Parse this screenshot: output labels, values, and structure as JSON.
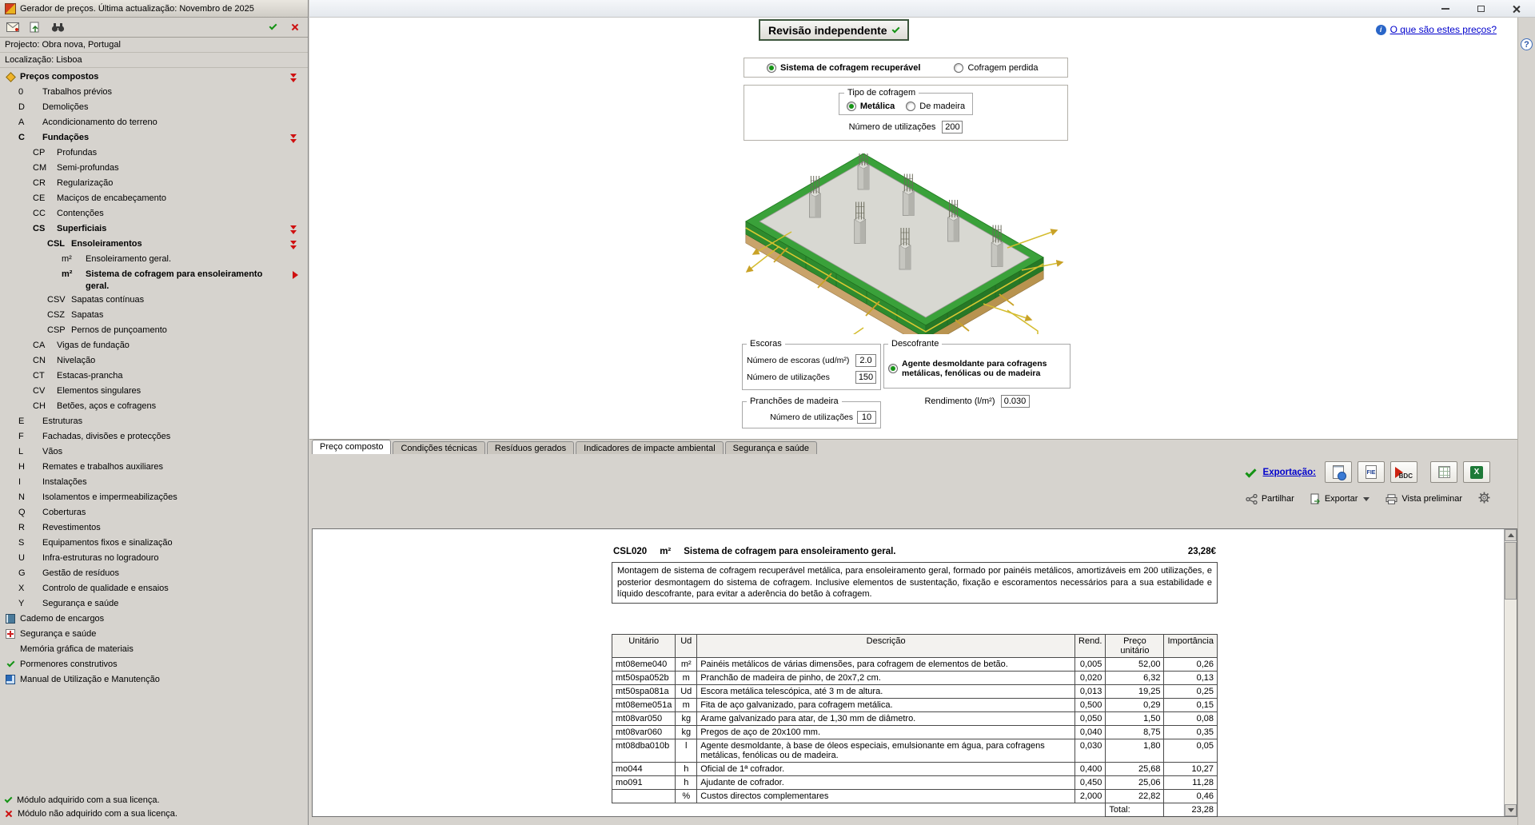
{
  "colors": {
    "accent_green": "#159415",
    "marker_red": "#cf1010",
    "link_blue": "#0000cc"
  },
  "left_panel": {
    "titlebar": "Gerador de preços. Última actualização: Novembro de 2025",
    "project": "Projecto: Obra nova, Portugal",
    "location": "Localização: Lisboa",
    "tree": [
      {
        "level": 0,
        "icon": "precos-compostos",
        "label": "Preços compostos",
        "bold": true,
        "marker": "expanded"
      },
      {
        "level": 1,
        "code": "0",
        "label": "Trabalhos prévios"
      },
      {
        "level": 1,
        "code": "D",
        "label": "Demolições"
      },
      {
        "level": 1,
        "code": "A",
        "label": "Acondicionamento do terreno"
      },
      {
        "level": 1,
        "code": "C",
        "label": "Fundações",
        "bold": true,
        "marker": "expanded"
      },
      {
        "level": 2,
        "code": "CP",
        "label": "Profundas"
      },
      {
        "level": 2,
        "code": "CM",
        "label": "Semi-profundas"
      },
      {
        "level": 2,
        "code": "CR",
        "label": "Regularização"
      },
      {
        "level": 2,
        "code": "CE",
        "label": "Maciços de encabeçamento"
      },
      {
        "level": 2,
        "code": "CC",
        "label": "Contenções"
      },
      {
        "level": 2,
        "code": "CS",
        "label": "Superficiais",
        "bold": true,
        "marker": "expanded"
      },
      {
        "level": 3,
        "code": "CSL",
        "label": "Ensoleiramentos",
        "bold": true,
        "marker": "expanded"
      },
      {
        "level": 4,
        "code": "m²",
        "label": "Ensoleiramento geral."
      },
      {
        "level": 4,
        "code": "m²",
        "label": "Sistema de cofragem para ensoleiramento geral.",
        "bold": true,
        "selected": true,
        "marker": "selected"
      },
      {
        "level": 3,
        "code": "CSV",
        "label": "Sapatas contínuas"
      },
      {
        "level": 3,
        "code": "CSZ",
        "label": "Sapatas"
      },
      {
        "level": 3,
        "code": "CSP",
        "label": "Pernos de punçoamento"
      },
      {
        "level": 2,
        "code": "CA",
        "label": "Vigas de fundação"
      },
      {
        "level": 2,
        "code": "CN",
        "label": "Nivelação"
      },
      {
        "level": 2,
        "code": "CT",
        "label": "Estacas-prancha"
      },
      {
        "level": 2,
        "code": "CV",
        "label": "Elementos singulares"
      },
      {
        "level": 2,
        "code": "CH",
        "label": "Betões, aços e cofragens"
      },
      {
        "level": 1,
        "code": "E",
        "label": "Estruturas"
      },
      {
        "level": 1,
        "code": "F",
        "label": "Fachadas, divisões e protecções"
      },
      {
        "level": 1,
        "code": "L",
        "label": "Vãos"
      },
      {
        "level": 1,
        "code": "H",
        "label": "Remates e trabalhos auxiliares"
      },
      {
        "level": 1,
        "code": "I",
        "label": "Instalações"
      },
      {
        "level": 1,
        "code": "N",
        "label": "Isolamentos e impermeabilizações"
      },
      {
        "level": 1,
        "code": "Q",
        "label": "Coberturas"
      },
      {
        "level": 1,
        "code": "R",
        "label": "Revestimentos"
      },
      {
        "level": 1,
        "code": "S",
        "label": "Equipamentos fixos e sinalização"
      },
      {
        "level": 1,
        "code": "U",
        "label": "Infra-estruturas no logradouro"
      },
      {
        "level": 1,
        "code": "G",
        "label": "Gestão de resíduos"
      },
      {
        "level": 1,
        "code": "X",
        "label": "Controlo de qualidade e ensaios"
      },
      {
        "level": 1,
        "code": "Y",
        "label": "Segurança e saúde"
      },
      {
        "level": 0,
        "icon": "caderno",
        "label": "Cademo de encargos"
      },
      {
        "level": 0,
        "icon": "seguranca",
        "label": "Segurança e saúde"
      },
      {
        "level": 0,
        "icon": "memoria",
        "label": "Memória gráfica de materiais"
      },
      {
        "level": 0,
        "icon": "check",
        "label": "Pormenores construtivos"
      },
      {
        "level": 0,
        "icon": "manual",
        "label": "Manual de Utilização e Manutenção"
      }
    ],
    "legend": [
      {
        "icon": "check",
        "text": "Módulo adquirido com a sua licença."
      },
      {
        "icon": "cross",
        "text": "Módulo não adquirido com a sua licença."
      }
    ]
  },
  "header": {
    "revision_label": "Revisão independente",
    "prices_link": "O que são estes preços?"
  },
  "options": {
    "radios": [
      {
        "label": "Sistema de cofragem recuperável",
        "selected": true
      },
      {
        "label": "Cofragem perdida",
        "selected": false
      }
    ],
    "tipo_cofragem": {
      "legend": "Tipo de cofragem",
      "radios": [
        {
          "label": "Metálica",
          "selected": true
        },
        {
          "label": "De madeira",
          "selected": false
        }
      ]
    },
    "num_utilizacoes": {
      "label": "Número de utilizações",
      "value": "200"
    }
  },
  "params": {
    "escoras": {
      "legend": "Escoras",
      "fields": [
        {
          "label": "Número de escoras (ud/m²)",
          "value": "2.0"
        },
        {
          "label": "Número de utilizações",
          "value": "150"
        }
      ]
    },
    "pranchoes": {
      "legend": "Pranchões de madeira",
      "fields": [
        {
          "label": "Número de utilizações",
          "value": "10"
        }
      ]
    },
    "descofrante": {
      "legend": "Descofrante",
      "radio_label": "Agente desmoldante para cofragens metálicas, fenólicas ou de madeira",
      "field": {
        "label": "Rendimento (l/m²)",
        "value": "0.030"
      }
    }
  },
  "tabs": [
    "Preço composto",
    "Condições técnicas",
    "Resíduos gerados",
    "Indicadores de impacte ambiental",
    "Segurança e saúde"
  ],
  "export_toolbar": {
    "exportacao": "Exportação:",
    "partilhar": "Partilhar",
    "exportar": "Exportar",
    "vista_preliminar": "Vista preliminar"
  },
  "document": {
    "code": "CSL020",
    "unit": "m²",
    "title": "Sistema de cofragem para ensoleiramento geral.",
    "price": "23,28€",
    "description": "Montagem de sistema de cofragem recuperável metálica, para ensoleiramento geral, formado por painéis metálicos, amortizáveis em 200 utilizações, e posterior desmontagem do sistema de cofragem. Inclusive elementos de sustentação, fixação e escoramentos necessários para a sua estabilidade e líquido descofrante, para evitar a aderência do betão à cofragem.",
    "table": {
      "headers": [
        "Unitário",
        "Ud",
        "Descrição",
        "Rend.",
        "Preço unitário",
        "Importância"
      ],
      "rows": [
        [
          "mt08eme040",
          "m²",
          "Painéis metálicos de várias dimensões, para cofragem de elementos de betão.",
          "0,005",
          "52,00",
          "0,26"
        ],
        [
          "mt50spa052b",
          "m",
          "Pranchão de madeira de pinho, de 20x7,2 cm.",
          "0,020",
          "6,32",
          "0,13"
        ],
        [
          "mt50spa081a",
          "Ud",
          "Escora metálica telescópica, até 3 m de altura.",
          "0,013",
          "19,25",
          "0,25"
        ],
        [
          "mt08eme051a",
          "m",
          "Fita de aço galvanizado, para cofragem metálica.",
          "0,500",
          "0,29",
          "0,15"
        ],
        [
          "mt08var050",
          "kg",
          "Arame galvanizado para atar, de 1,30 mm de diâmetro.",
          "0,050",
          "1,50",
          "0,08"
        ],
        [
          "mt08var060",
          "kg",
          "Pregos de aço de 20x100 mm.",
          "0,040",
          "8,75",
          "0,35"
        ],
        [
          "mt08dba010b",
          "l",
          "Agente desmoldante, à base de óleos especiais, emulsionante em água, para cofragens metálicas, fenólicas ou de madeira.",
          "0,030",
          "1,80",
          "0,05"
        ],
        [
          "mo044",
          "h",
          "Oficial de 1ª cofrador.",
          "0,400",
          "25,68",
          "10,27"
        ],
        [
          "mo091",
          "h",
          "Ajudante de cofrador.",
          "0,450",
          "25,06",
          "11,28"
        ],
        [
          "",
          "%",
          "Custos directos complementares",
          "2,000",
          "22,82",
          "0,46"
        ]
      ],
      "total_label": "Total:",
      "total_value": "23,28"
    }
  }
}
